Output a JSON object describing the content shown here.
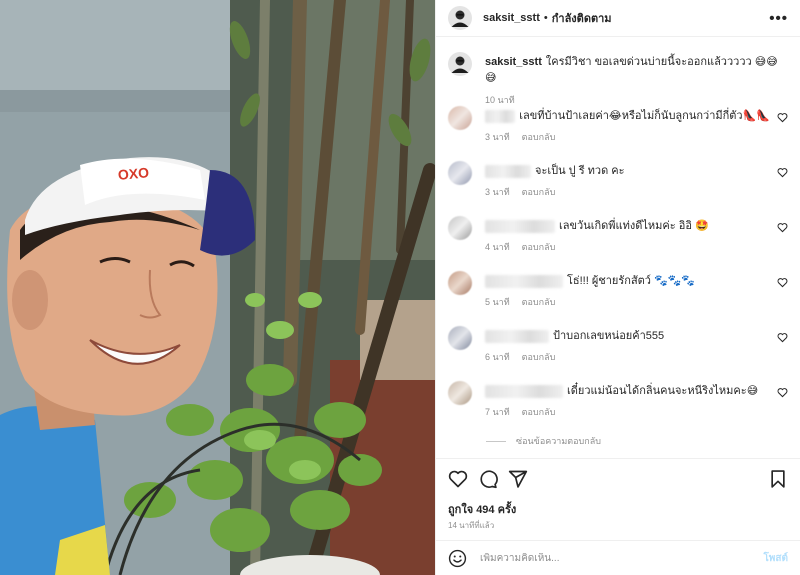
{
  "header": {
    "username": "saksit_sstt",
    "separator": "•",
    "follow_status": "กำลังติดตาม",
    "more_icon": "more-horizontal-icon"
  },
  "caption": {
    "username": "saksit_sstt",
    "text": "ใครมีวิชา ขอเลขด่วนบ่ายนี้จะออกแล้ววววว 😅😅😅",
    "time": "10 นาที"
  },
  "cap_label": "OXO",
  "comments": [
    {
      "text": "เลขที่บ้านป้าเลยค่า😂หรือไม่ก็นับลูกนกว่ามีกี่ตัว👠👠",
      "time": "3 นาที",
      "reply": "ตอบกลับ"
    },
    {
      "text": "จะเป็น ปู รี ทวด คะ",
      "time": "3 นาที",
      "reply": "ตอบกลับ"
    },
    {
      "text": "เลขวันเกิดพี่แท่งดีไหมค่ะ อิอิ 🤩",
      "time": "4 นาที",
      "reply": "ตอบกลับ"
    },
    {
      "text": "โธ่!!! ผู้ชายรักสัตว์ 🐾🐾🐾",
      "time": "5 นาที",
      "reply": "ตอบกลับ"
    },
    {
      "text": "ป้าบอกเลขหน่อยค้า555",
      "time": "6 นาที",
      "reply": "ตอบกลับ"
    },
    {
      "text": "เดี๋ยวแม่น้อนได้กลิ่นคนจะหนีริงไหมคะ😅",
      "time": "7 นาที",
      "reply": "ตอบกลับ"
    }
  ],
  "view_replies": "ซ่อนข้อความตอบกลับ",
  "actions": {
    "like_icon": "heart-icon",
    "comment_icon": "comment-icon",
    "share_icon": "send-icon",
    "save_icon": "bookmark-icon",
    "likes": "ถูกใจ 494 ครั้ง",
    "posted": "14 นาทีที่แล้ว"
  },
  "add_comment": {
    "emoji_icon": "smiley-icon",
    "placeholder": "เพิ่มความคิดเห็น...",
    "post_label": "โพสต์"
  },
  "colors": {
    "accent_disabled": "#b2dffc",
    "secondary_text": "#8e8e8e",
    "divider": "#efefef"
  }
}
